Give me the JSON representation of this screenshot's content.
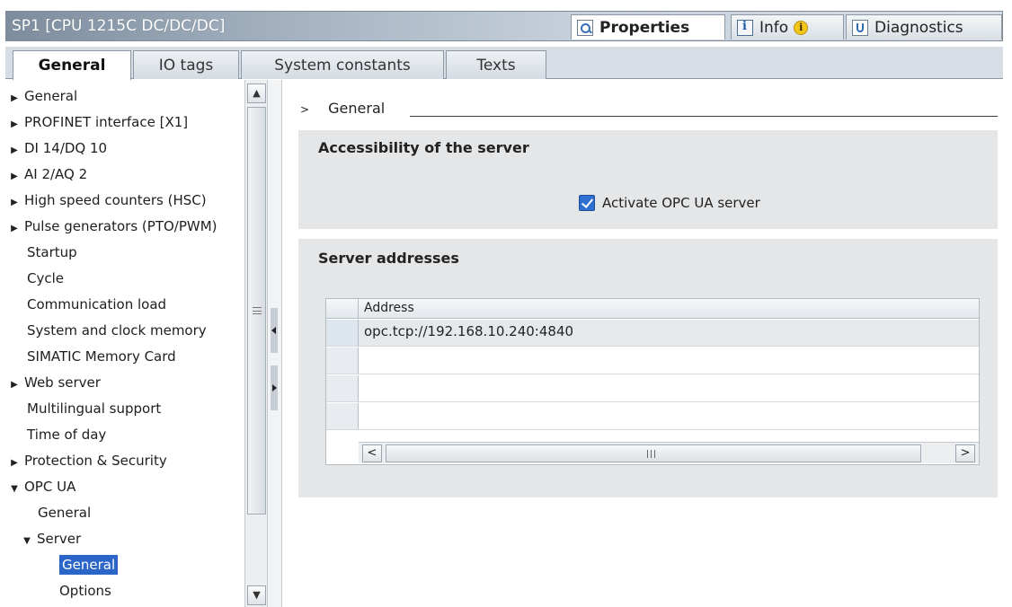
{
  "window": {
    "title": "SP1 [CPU 1215C DC/DC/DC]",
    "inspector_tabs": [
      {
        "label": "Properties",
        "icon": "properties-icon",
        "active": true
      },
      {
        "label": "Info",
        "icon": "info-icon",
        "badge_icon": "info-badge-icon"
      },
      {
        "label": "Diagnostics",
        "icon": "diagnostics-icon"
      }
    ]
  },
  "property_tabs": [
    "General",
    "IO tags",
    "System constants",
    "Texts"
  ],
  "nav": {
    "items": [
      {
        "label": "General",
        "expandable": true
      },
      {
        "label": "PROFINET interface [X1]",
        "expandable": true
      },
      {
        "label": "DI 14/DQ 10",
        "expandable": true
      },
      {
        "label": "AI 2/AQ 2",
        "expandable": true
      },
      {
        "label": "High speed counters (HSC)",
        "expandable": true
      },
      {
        "label": "Pulse generators (PTO/PWM)",
        "expandable": true
      },
      {
        "label": "Startup"
      },
      {
        "label": "Cycle"
      },
      {
        "label": "Communication load"
      },
      {
        "label": "System and clock memory"
      },
      {
        "label": "SIMATIC Memory Card"
      },
      {
        "label": "Web server",
        "expandable": true
      },
      {
        "label": "Multilingual support"
      },
      {
        "label": "Time of day"
      },
      {
        "label": "Protection & Security",
        "expandable": true
      },
      {
        "label": "OPC UA",
        "expanded": true
      },
      {
        "label": "General"
      },
      {
        "label": "Server",
        "expanded": true
      },
      {
        "label": "General",
        "selected": true
      },
      {
        "label": "Options"
      }
    ]
  },
  "content": {
    "section_header": "General",
    "accessibility": {
      "title": "Accessibility of the server",
      "checkbox_label": "Activate OPC UA server",
      "checked": true
    },
    "server_addresses": {
      "title": "Server addresses",
      "column": "Address",
      "rows": [
        "opc.tcp://192.168.10.240:4840"
      ]
    }
  },
  "colors": {
    "selection": "#2a65c7",
    "panel": "#e4e6e8",
    "checkbox": "#2f6fd0"
  }
}
